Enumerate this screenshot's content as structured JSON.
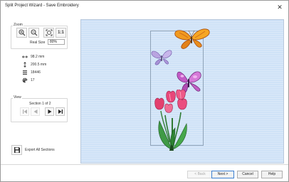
{
  "window": {
    "title": "Split Project Wizard - Save Embroidery",
    "close_icon": "close-icon"
  },
  "zoom": {
    "label": "Zoom",
    "tools": [
      {
        "name": "zoom-in",
        "icon": "zoom-in-icon"
      },
      {
        "name": "zoom-out",
        "icon": "zoom-out-icon"
      },
      {
        "name": "zoom-to-fit",
        "icon": "zoom-fit-icon"
      },
      {
        "name": "actual-size",
        "icon": "one-to-one-icon",
        "text": "1:1"
      }
    ],
    "real_size_label": "Real Size",
    "real_size_value": "80%"
  },
  "info": {
    "width": "98.2 mm",
    "height": "200.5 mm",
    "stitches": "18446",
    "colors": "17"
  },
  "view": {
    "label": "View",
    "section_text": "Section 1 of 2"
  },
  "export": {
    "label": "Export All Sections"
  },
  "buttons": {
    "back": "< Back",
    "next": "Next >",
    "cancel": "Cancel",
    "help": "Help"
  },
  "colors": {
    "canvas": "#cfe2f7",
    "accent": "#3c7fd0"
  }
}
